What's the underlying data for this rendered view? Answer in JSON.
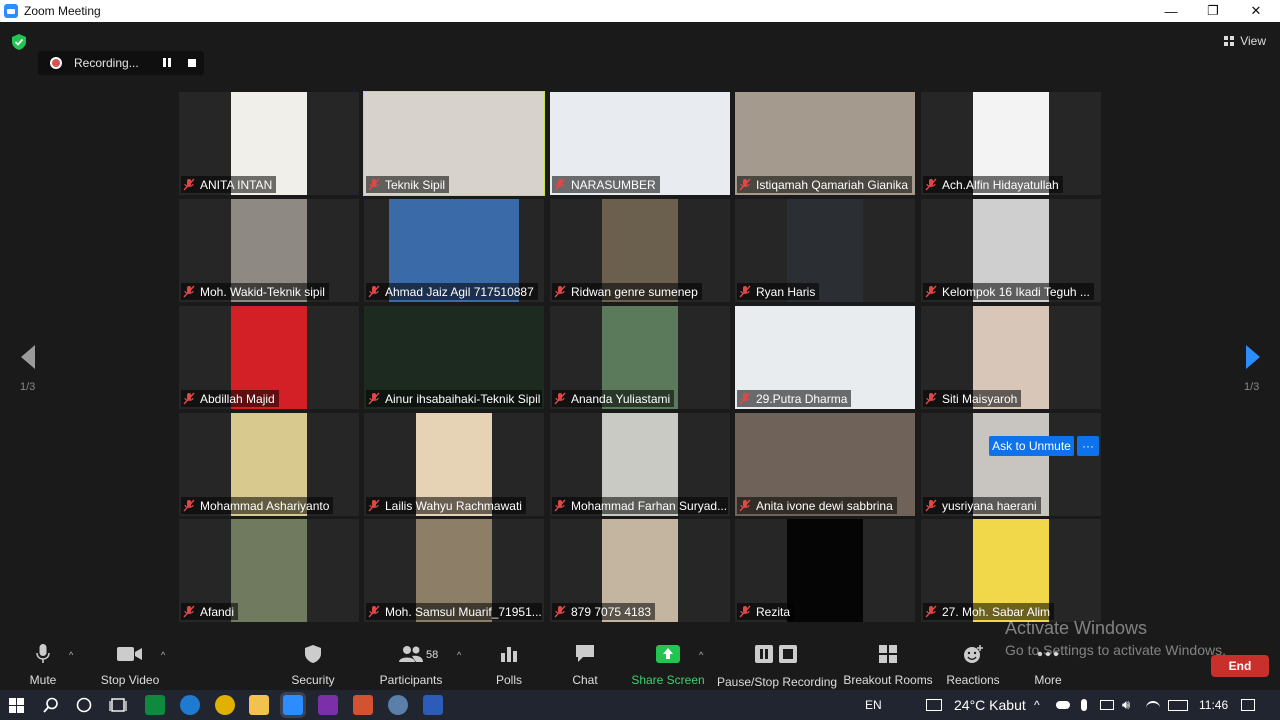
{
  "window": {
    "title": "Zoom Meeting",
    "minimize": "—",
    "restore": "❐",
    "close": "✕"
  },
  "recording": {
    "label": "Recording..."
  },
  "view": {
    "label": "View"
  },
  "pagination": {
    "prev_page": "1/3",
    "next_page": "1/3"
  },
  "participants_grid": [
    {
      "name": "ANITA INTAN",
      "bg": "#f1efe9"
    },
    {
      "name": "Teknik Sipil",
      "bg": "#d7d3cc",
      "active": true
    },
    {
      "name": "NARASUMBER",
      "bg": "#e8ecf0"
    },
    {
      "name": "Istiqamah Qamariah Gianika",
      "bg": "#a49b8e"
    },
    {
      "name": "Ach.Alfin Hidayatullah",
      "bg": "#f3f3f3"
    },
    {
      "name": "Moh. Wakid-Teknik sipil",
      "bg": "#8e8a83"
    },
    {
      "name": "Ahmad Jaiz Agil  717510887",
      "bg": "#3a6aa8"
    },
    {
      "name": "Ridwan genre sumenep",
      "bg": "#6b5f4e"
    },
    {
      "name": "Ryan Haris",
      "bg": "#2b2f33"
    },
    {
      "name": "Kelompok 16 Ikadi Teguh ...",
      "bg": "#cfcfcf"
    },
    {
      "name": "Abdillah Majid",
      "bg": "#d32027"
    },
    {
      "name": "Ainur ihsabaihaki-Teknik Sipil",
      "bg": "#1d2a1f"
    },
    {
      "name": "Ananda Yuliastami",
      "bg": "#5b7a5c"
    },
    {
      "name": "29.Putra Dharma",
      "bg": "#e9ecee"
    },
    {
      "name": "Siti Maisyaroh",
      "bg": "#d8c6b8"
    },
    {
      "name": "Mohammad Ashariyanto",
      "bg": "#d8c98f"
    },
    {
      "name": "Lailis Wahyu Rachmawati",
      "bg": "#e6d2b4"
    },
    {
      "name": "Mohammad Farhan Suryad...",
      "bg": "#c9cac4"
    },
    {
      "name": "Anita ivone dewi sabbrina",
      "bg": "#6f6258"
    },
    {
      "name": "yusriyana haerani",
      "bg": "#c8c4bf"
    },
    {
      "name": "Afandi",
      "bg": "#6f7a5f"
    },
    {
      "name": "Moh. Samsul Muarif_71951...",
      "bg": "#8c7e67"
    },
    {
      "name": "879 7075 4183",
      "bg": "#c4b5a0"
    },
    {
      "name": "Rezita",
      "bg": "#050505"
    },
    {
      "name": "27. Moh. Sabar Alim",
      "bg": "#f0d84a"
    }
  ],
  "tile_overlay": {
    "ask_unmute": "Ask to Unmute",
    "more": "···"
  },
  "toolbar": {
    "mute": "Mute",
    "stop_video": "Stop Video",
    "security": "Security",
    "participants": "Participants",
    "participants_count": "58",
    "polls": "Polls",
    "chat": "Chat",
    "share_screen": "Share Screen",
    "pause_stop_recording": "Pause/Stop Recording",
    "breakout_rooms": "Breakout Rooms",
    "reactions": "Reactions",
    "more": "More",
    "end": "End"
  },
  "watermark": {
    "line1": "Activate Windows",
    "line2": "Go to Settings to activate Windows."
  },
  "taskbar": {
    "language": "EN",
    "weather": "24°C  Kabut",
    "time": "11:46"
  },
  "colors": {
    "accent_blue": "#0e72ed",
    "share_green": "#3bd16f",
    "end_red": "#c9302c",
    "active_speaker": "#c8e03a"
  }
}
